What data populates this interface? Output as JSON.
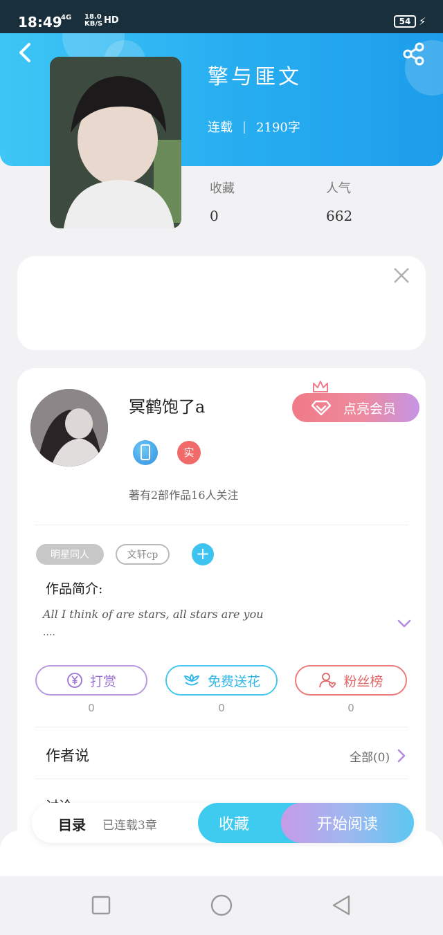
{
  "status_bar": {
    "time": "18:49",
    "network": "4G",
    "network_up": "ᵗ⁴ᴳ",
    "speed": "18.0",
    "speed_unit": "KB/S",
    "hd": "HD",
    "battery": "54"
  },
  "header": {
    "back_icon": "back-arrow-icon",
    "share_icon": "share-icon"
  },
  "book": {
    "title": "擎与匪文",
    "status": "连载",
    "word_count": "2190字",
    "stats": [
      {
        "label": "收藏",
        "value": "0"
      },
      {
        "label": "人气",
        "value": "662"
      }
    ]
  },
  "ad": {
    "close_icon": "close-icon"
  },
  "author": {
    "name": "冥鹤饱了a",
    "vip_button": "点亮会员",
    "badge_real": "实",
    "stats_text": "著有2部作品16人关注"
  },
  "tags": {
    "items": [
      "明星同人",
      "文轩cp"
    ],
    "add_label": "+"
  },
  "intro": {
    "title": "作品简介:",
    "text": "All I think of are stars, all stars are you",
    "more": "...."
  },
  "actions": [
    {
      "label": "打赏",
      "count": "0",
      "icon": "yen-icon",
      "color": "#9b72d3"
    },
    {
      "label": "免费送花",
      "count": "0",
      "icon": "flower-icon",
      "color": "#2eb6e6"
    },
    {
      "label": "粉丝榜",
      "count": "0",
      "icon": "fan-icon",
      "color": "#e06565"
    }
  ],
  "author_says": {
    "title": "作者说",
    "all_link": "全部(0)"
  },
  "peek": {
    "text": "讨论"
  },
  "bottom_bar": {
    "toc_label": "目录",
    "chapters_text": "已连载3章",
    "favorite_button": "收藏",
    "read_button": "开始阅读"
  },
  "nav": {
    "recent_icon": "square-icon",
    "home_icon": "circle-icon",
    "back_icon": "triangle-back-icon"
  }
}
